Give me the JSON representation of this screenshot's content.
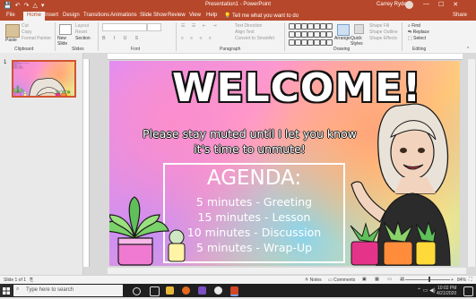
{
  "titlebar": {
    "doc_title": "Presentation1 - PowerPoint",
    "user_name": "Carrey Ryder",
    "qat": [
      "💾",
      "↶",
      "↷",
      "△",
      "▾"
    ],
    "window_controls": [
      "—",
      "☐",
      "✕"
    ]
  },
  "tabs": [
    "File",
    "Home",
    "Insert",
    "Design",
    "Transitions",
    "Animations",
    "Slide Show",
    "Review",
    "View",
    "Help",
    "💡 Tell me what you want to do"
  ],
  "active_tab": "Home",
  "share_label": "Share",
  "ribbon": {
    "paste": "Paste",
    "cut": "Cut",
    "copy": "Copy",
    "format_painter": "Format Painter",
    "new_slide": "New Slide",
    "layout": "Layout",
    "reset": "Reset",
    "section": "Section",
    "text_direction": "Text Direction",
    "align_text": "Align Text",
    "convert_smartart": "Convert to SmartArt",
    "arrange": "Arrange",
    "quick_styles": "Quick Styles",
    "shape_fill": "Shape Fill",
    "shape_outline": "Shape Outline",
    "shape_effects": "Shape Effects",
    "find": "Find",
    "replace": "Replace",
    "select": "Select",
    "groups": [
      "Clipboard",
      "Slides",
      "Font",
      "Paragraph",
      "Drawing",
      "Editing"
    ]
  },
  "thumbnail": {
    "number": "1"
  },
  "slide": {
    "title": "WELCOME!",
    "subtitle_line1": "Please stay muted until I let you know",
    "subtitle_line2": "it's time to unmute!",
    "agenda_title": "AGENDA:",
    "agenda_items": [
      "5 minutes - Greeting",
      "15 minutes - Lesson",
      "10 minutes - Discussion",
      "5 minutes - Wrap-Up"
    ]
  },
  "statusbar": {
    "slide_info": "Slide 1 of 1",
    "notes": "Notes",
    "comments": "Comments",
    "zoom": "84%"
  },
  "taskbar": {
    "search_placeholder": "Type here to search",
    "time": "10:02 PM",
    "date": "4/21/2020"
  },
  "colors": {
    "accent": "#b7472a",
    "taskbar": "#1f1f1f"
  }
}
